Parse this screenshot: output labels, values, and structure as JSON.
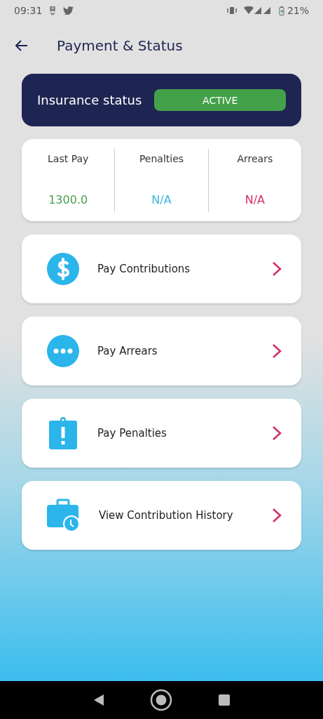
{
  "status_bar": {
    "time": "09:31",
    "battery": "21%"
  },
  "header": {
    "title": "Payment & Status"
  },
  "insurance": {
    "label": "Insurance status",
    "status": "ACTIVE",
    "active": true
  },
  "stats": [
    {
      "label": "Last Pay",
      "value": "1300.0",
      "color": "#4a9e4e"
    },
    {
      "label": "Penalties",
      "value": "N/A",
      "color": "#3bb6dc"
    },
    {
      "label": "Arrears",
      "value": "N/A",
      "color": "#d22f6a"
    }
  ],
  "menu": [
    {
      "kind": "dollar",
      "label": "Pay Contributions"
    },
    {
      "kind": "dots",
      "label": "Pay Arrears"
    },
    {
      "kind": "alert",
      "label": "Pay Penalties"
    },
    {
      "kind": "history",
      "label": "View Contribution History"
    }
  ]
}
